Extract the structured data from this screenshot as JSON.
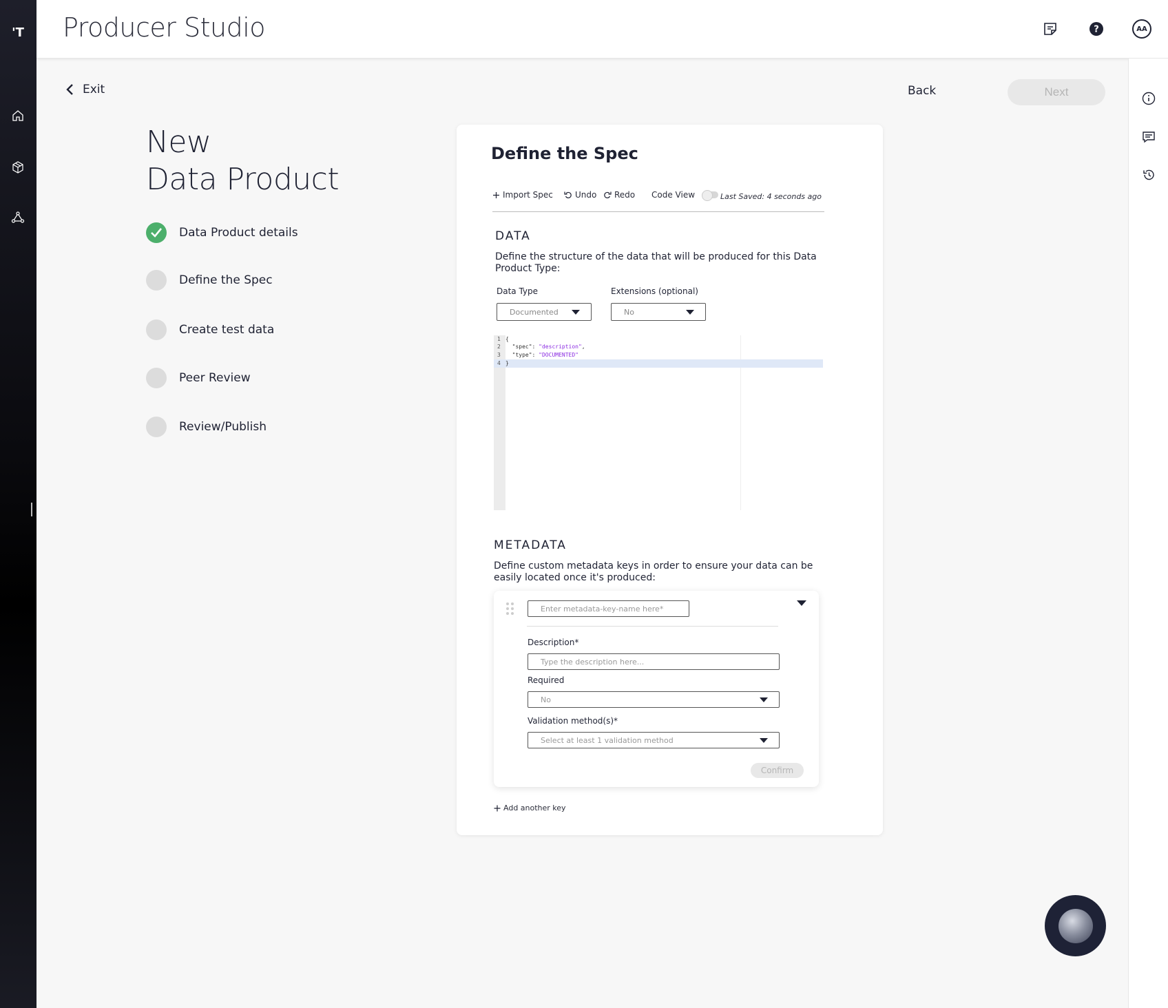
{
  "app": {
    "title": "Producer Studio",
    "logo_text": "'T"
  },
  "header": {
    "avatar_initials": "AA"
  },
  "nav": {
    "exit_label": "Exit",
    "back_label": "Back",
    "next_label": "Next"
  },
  "page": {
    "heading_line1": "New",
    "heading_line2": "Data Product"
  },
  "steps": [
    {
      "label": "Data Product details",
      "status": "done"
    },
    {
      "label": "Define the Spec",
      "status": "pending"
    },
    {
      "label": "Create test data",
      "status": "pending"
    },
    {
      "label": "Peer Review",
      "status": "pending"
    },
    {
      "label": "Review/Publish",
      "status": "pending"
    }
  ],
  "card": {
    "title": "Define the Spec",
    "toolbar": {
      "import_label": "Import Spec",
      "undo_label": "Undo",
      "redo_label": "Redo",
      "code_view_label": "Code View",
      "last_saved": "Last Saved: 4 seconds ago"
    },
    "data_section": {
      "heading": "DATA",
      "description": "Define the structure of the data that will be produced for this Data Product Type:",
      "data_type_label": "Data Type",
      "data_type_value": "Documented",
      "extensions_label": "Extensions (optional)",
      "extensions_value": "No"
    },
    "code": {
      "line1": "{",
      "line2_key": "\"spec\": ",
      "line2_val": "\"description\"",
      "line2_end": ",",
      "line3_key": "\"type\": ",
      "line3_val": "\"DOCUMENTED\"",
      "line4": "}",
      "ln1": "1",
      "ln2": "2",
      "ln3": "3",
      "ln4": "4"
    },
    "metadata_section": {
      "heading": "METADATA",
      "description": "Define custom metadata keys in order to ensure your data can be easily located once it's produced:",
      "key_placeholder": "Enter metadata-key-name here*",
      "description_label": "Description*",
      "description_placeholder": "Type the description here...",
      "required_label": "Required",
      "required_value": "No",
      "validation_label": "Validation method(s)*",
      "validation_placeholder": "Select at least 1 validation method",
      "confirm_label": "Confirm",
      "add_key_label": "Add another key"
    }
  },
  "colors": {
    "accent_done": "#4caf6b",
    "rail": "#000000",
    "card_bg": "#ffffff"
  }
}
